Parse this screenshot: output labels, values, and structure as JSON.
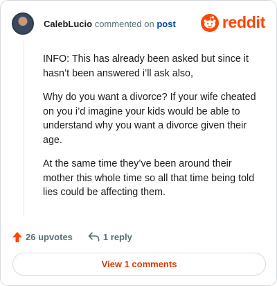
{
  "comment": {
    "username": "CalebLucio",
    "action_text": "commented on",
    "post_link": "post",
    "paragraphs": [
      "INFO: This has already been asked but since it hasn’t been answered i’ll ask also,",
      "Why do you want a divorce? If your wife cheated on you i’d imagine your kids would be able to understand why you want a divorce given their age.",
      "At the same time they’ve been around their mother this whole time so all that time being told lies could be affecting them."
    ]
  },
  "brand": {
    "name": "reddit",
    "color": "#ff4500",
    "icon": "reddit-snoo-icon"
  },
  "actions": {
    "upvotes_label": "26 upvotes",
    "upvote_icon": "upvote-arrow-icon",
    "upvote_color": "#ff4500",
    "reply_label": "1 reply",
    "reply_icon": "reply-arrow-icon"
  },
  "footer": {
    "view_button_label": "View 1 comments",
    "accent_color": "#d93a00"
  }
}
